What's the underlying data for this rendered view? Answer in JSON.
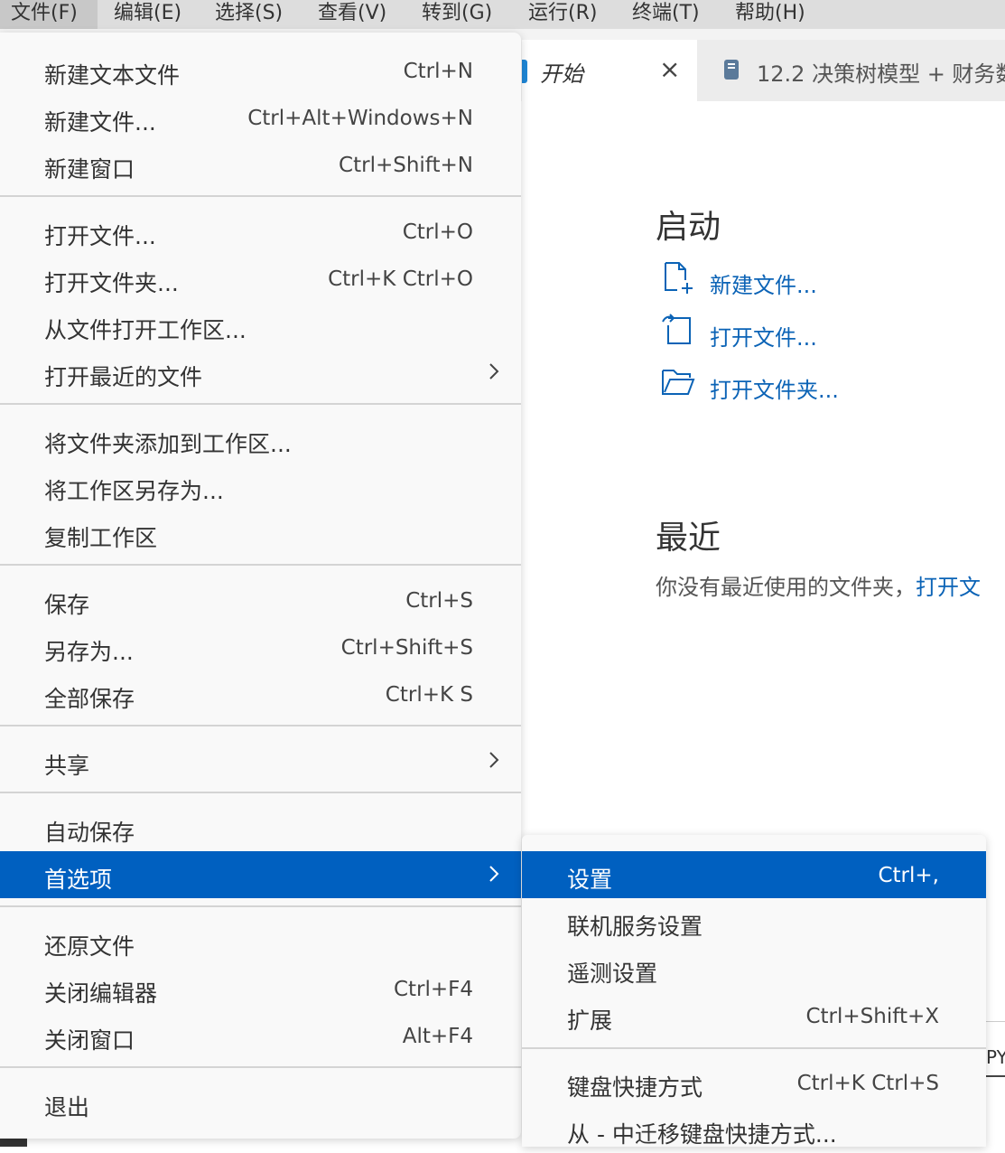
{
  "menubar": {
    "items": [
      "文件(F)",
      "编辑(E)",
      "选择(S)",
      "查看(V)",
      "转到(G)",
      "运行(R)",
      "终端(T)",
      "帮助(H)"
    ]
  },
  "tabs": {
    "start_label": "开始",
    "close_icon": "×",
    "notebook_label": "12.2 决策树模型 + 财务数"
  },
  "welcome": {
    "start_heading": "启动",
    "new_file": "新建文件...",
    "open_file": "打开文件...",
    "open_folder": "打开文件夹...",
    "recent_heading": "最近",
    "recent_text": "你没有最近使用的文件夹，",
    "recent_link": "打开文"
  },
  "file_menu": {
    "items": [
      {
        "label": "新建文本文件",
        "shortcut": "Ctrl+N"
      },
      {
        "label": "新建文件...",
        "shortcut": "Ctrl+Alt+Windows+N"
      },
      {
        "label": "新建窗口",
        "shortcut": "Ctrl+Shift+N"
      },
      {
        "label": "打开文件...",
        "shortcut": "Ctrl+O"
      },
      {
        "label": "打开文件夹...",
        "shortcut": "Ctrl+K Ctrl+O"
      },
      {
        "label": "从文件打开工作区...",
        "shortcut": ""
      },
      {
        "label": "打开最近的文件",
        "shortcut": ""
      },
      {
        "label": "将文件夹添加到工作区...",
        "shortcut": ""
      },
      {
        "label": "将工作区另存为...",
        "shortcut": ""
      },
      {
        "label": "复制工作区",
        "shortcut": ""
      },
      {
        "label": "保存",
        "shortcut": "Ctrl+S"
      },
      {
        "label": "另存为...",
        "shortcut": "Ctrl+Shift+S"
      },
      {
        "label": "全部保存",
        "shortcut": "Ctrl+K S"
      },
      {
        "label": "共享",
        "shortcut": ""
      },
      {
        "label": "自动保存",
        "shortcut": ""
      },
      {
        "label": "首选项",
        "shortcut": ""
      },
      {
        "label": "还原文件",
        "shortcut": ""
      },
      {
        "label": "关闭编辑器",
        "shortcut": "Ctrl+F4"
      },
      {
        "label": "关闭窗口",
        "shortcut": "Alt+F4"
      },
      {
        "label": "退出",
        "shortcut": ""
      }
    ]
  },
  "preferences_submenu": {
    "items": [
      {
        "label": "设置",
        "shortcut": "Ctrl+,"
      },
      {
        "label": "联机服务设置",
        "shortcut": ""
      },
      {
        "label": "遥测设置",
        "shortcut": ""
      },
      {
        "label": "扩展",
        "shortcut": "Ctrl+Shift+X"
      },
      {
        "label": "键盘快捷方式",
        "shortcut": "Ctrl+K Ctrl+S"
      },
      {
        "label": "从 - 中迁移键盘快捷方式...",
        "shortcut": ""
      }
    ]
  },
  "partial_text": "PY",
  "colors": {
    "accent": "#0060c0",
    "link": "#0b63b6"
  }
}
